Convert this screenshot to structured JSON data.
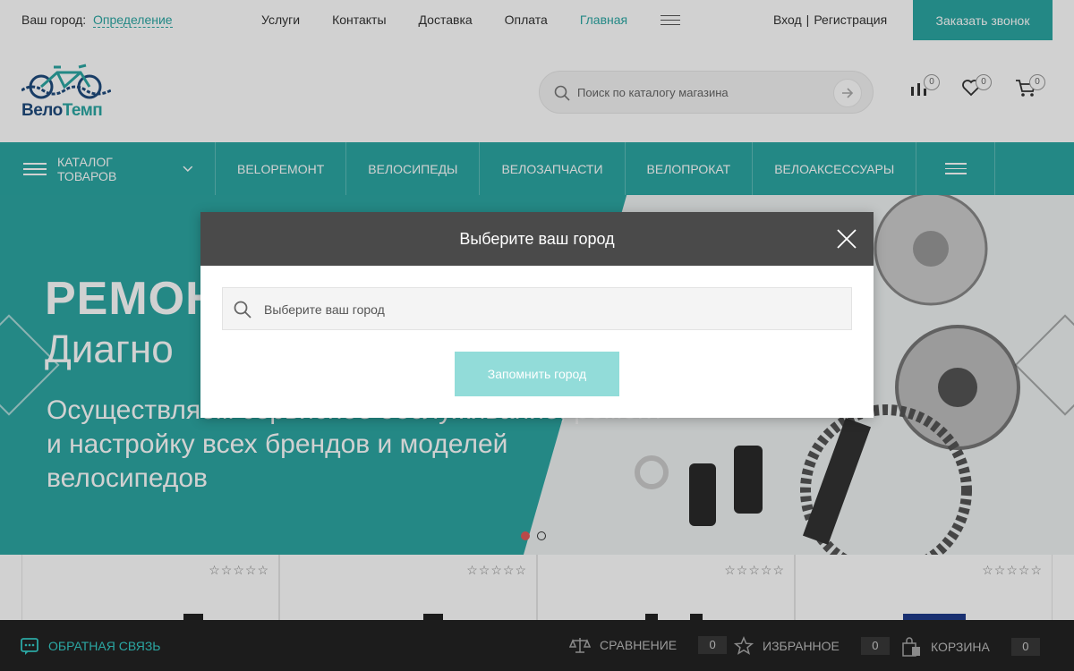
{
  "topbar": {
    "city_label": "Ваш город:",
    "city_value": "Определение",
    "nav": [
      "Услуги",
      "Контакты",
      "Доставка",
      "Оплата",
      "Главная"
    ],
    "login": "Вход",
    "separator": "|",
    "register": "Регистрация",
    "call_button": "Заказать звонок"
  },
  "header": {
    "logo_part1": "Вело",
    "logo_part2": "Темп",
    "search_placeholder": "Поиск по каталогу магазина",
    "compare_count": "0",
    "favorites_count": "0",
    "cart_count": "0"
  },
  "mainnav": {
    "catalog": "Каталог товаров",
    "items": [
      "Веloремонт",
      "Велосипеды",
      "Велозапчасти",
      "Велопрокат",
      "Велоаксессуары"
    ]
  },
  "banner": {
    "title": "РЕМОН",
    "subtitle": "Диагно",
    "text": "Осуществляем сервисное обслуживание, ремонт и настройку всех брендов и моделей велосипедов"
  },
  "modal": {
    "title": "Выберите ваш город",
    "placeholder": "Выберите ваш город",
    "button": "Запомнить город"
  },
  "bottombar": {
    "feedback": "ОБРАТНАЯ СВЯЗЬ",
    "compare": "СРАВНЕНИЕ",
    "compare_count": "0",
    "favorites": "ИЗБРАННОЕ",
    "favorites_count": "0",
    "cart": "КОРЗИНА",
    "cart_count": "0"
  },
  "colors": {
    "accent": "#2ba7a3",
    "modal_header": "#4a4a4a",
    "button_disabled": "#92dcd9",
    "bottom_bar": "#1c1c1c"
  }
}
